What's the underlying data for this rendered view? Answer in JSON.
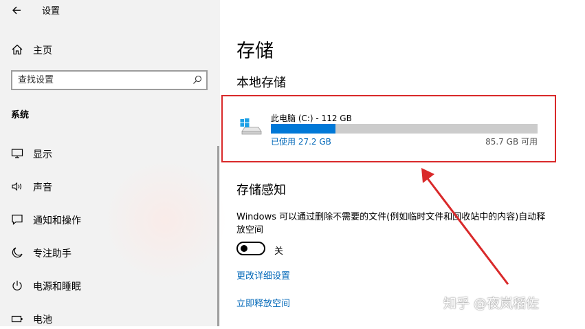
{
  "window": {
    "title": "设置"
  },
  "sidebar": {
    "home_label": "主页",
    "search_placeholder": "查找设置",
    "section_title": "系统",
    "items": [
      {
        "label": "显示",
        "icon": "monitor-icon"
      },
      {
        "label": "声音",
        "icon": "speaker-icon"
      },
      {
        "label": "通知和操作",
        "icon": "message-icon"
      },
      {
        "label": "专注助手",
        "icon": "moon-icon"
      },
      {
        "label": "电源和睡眠",
        "icon": "power-icon"
      },
      {
        "label": "电池",
        "icon": "battery-icon"
      }
    ]
  },
  "main": {
    "title": "存储",
    "local_storage_title": "本地存储",
    "drive": {
      "name": "此电脑 (C:) - 112 GB",
      "used_label": "已使用 27.2 GB",
      "free_label": "85.7 GB 可用",
      "used_fraction": 0.243
    },
    "storage_sense": {
      "title": "存储感知",
      "description": "Windows 可以通过删除不需要的文件(例如临时文件和回收站中的内容)自动释放空间",
      "toggle_state": "关",
      "links": [
        "更改详细设置",
        "立即释放空间"
      ]
    }
  },
  "watermark": "知乎 @夜岚稻佐",
  "colors": {
    "accent": "#0078d7",
    "link": "#0067b8",
    "annotation": "#d9292a"
  }
}
